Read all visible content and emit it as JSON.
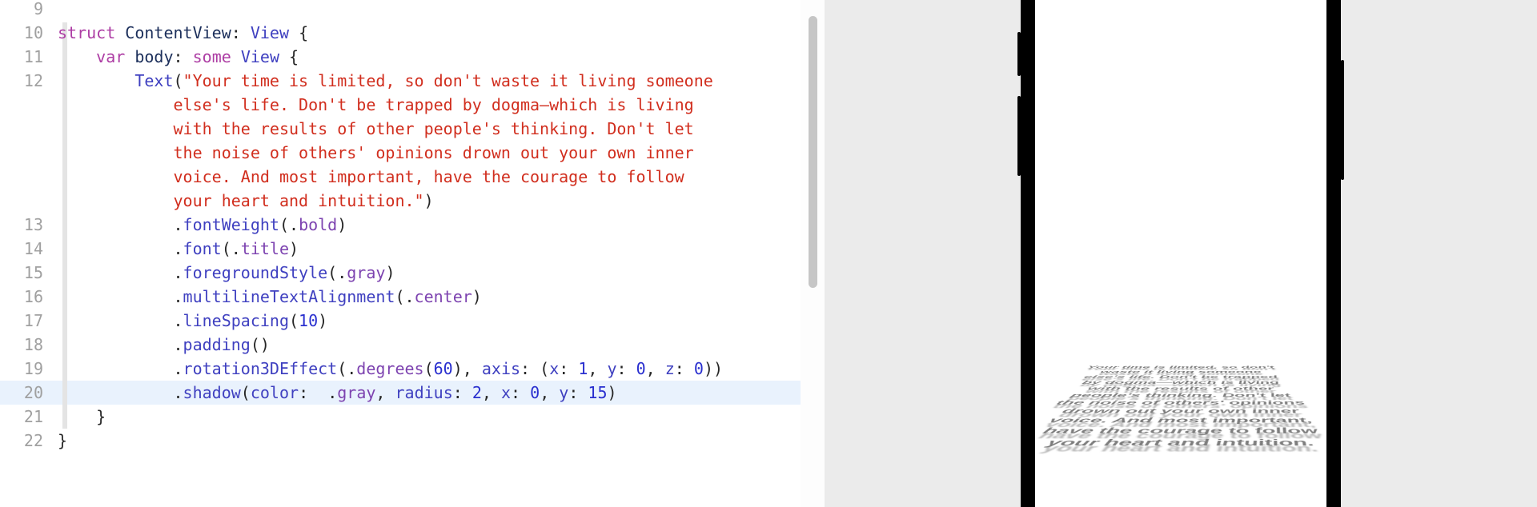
{
  "code": {
    "quote_text": "Your time is limited, so don't waste it living someone else's life. Don't be trapped by dogma—which is living with the results of other people's thinking. Don't let the noise of others' opinions drown out your own inner voice. And most important, have the courage to follow your heart and intuition.",
    "lines": {
      "l9": {
        "num": "9"
      },
      "l10": {
        "num": "10",
        "kw_struct": "struct",
        "name": "ContentView",
        "colon": ":",
        "type": "View",
        "brace": "{"
      },
      "l11": {
        "num": "11",
        "kw_var": "var",
        "name": "body",
        "colon": ":",
        "kw_some": "some",
        "type": "View",
        "brace": "{"
      },
      "l12": {
        "num": "12",
        "callee": "Text",
        "open": "(\"",
        "s1": "Your time is limited, so don't waste it living someone",
        "s2": "else's life. Don't be trapped by dogma—which is living",
        "s3": "with the results of other people's thinking. Don't let",
        "s4": "the noise of others' opinions drown out your own inner",
        "s5": "voice. And most important, have the courage to follow",
        "s6": "your heart and intuition.\"",
        "close": ")"
      },
      "l13": {
        "num": "13",
        "dot": ".",
        "call": "fontWeight",
        "open": "(",
        "arg": ".bold",
        "close": ")"
      },
      "l14": {
        "num": "14",
        "dot": ".",
        "call": "font",
        "open": "(",
        "arg": ".title",
        "close": ")"
      },
      "l15": {
        "num": "15",
        "dot": ".",
        "call": "foregroundStyle",
        "open": "(",
        "arg": ".gray",
        "close": ")"
      },
      "l16": {
        "num": "16",
        "dot": ".",
        "call": "multilineTextAlignment",
        "open": "(",
        "arg": ".center",
        "close": ")"
      },
      "l17": {
        "num": "17",
        "dot": ".",
        "call": "lineSpacing",
        "open": "(",
        "arg": "10",
        "close": ")"
      },
      "l18": {
        "num": "18",
        "dot": ".",
        "call": "padding",
        "open": "(",
        "close": ")"
      },
      "l19": {
        "num": "19",
        "dot": ".",
        "call": "rotation3DEffect",
        "open": "(",
        "deg_member": ".degrees",
        "deg_open": "(",
        "deg_val": "60",
        "deg_close": ")",
        "comma1": ", ",
        "axis_label": "axis",
        "axis_colon": ": ",
        "axp_open": "(",
        "xlab": "x",
        "xcolon": ": ",
        "xval": "1",
        "c2": ", ",
        "ylab": "y",
        "ycolon": ": ",
        "yval": "0",
        "c3": ", ",
        "zlab": "z",
        "zcolon": ": ",
        "zval": "0",
        "axp_close": ")",
        "close": ")"
      },
      "l20": {
        "num": "20",
        "dot": ".",
        "call": "shadow",
        "open": "(",
        "clab": "color",
        "ccolon": ": ",
        "cval": ".gray",
        "c1": ", ",
        "rlab": "radius",
        "rcolon": ": ",
        "rval": "2",
        "c2": ", ",
        "xlab": "x",
        "xcolon": ": ",
        "xval": "0",
        "c3": ", ",
        "ylab": "y",
        "ycolon": ": ",
        "yval": "15",
        "close": ")"
      },
      "l21": {
        "num": "21",
        "brace": "}"
      },
      "l22": {
        "num": "22",
        "brace": "}"
      }
    }
  },
  "preview": {
    "text": "Your time is limited, so don't waste it living someone else's life. Don't be trapped by dogma—which is living with the results of other people's thinking. Don't let the noise of others' opinions drown out your own inner voice. And most important, have the courage to follow your heart and intuition."
  },
  "colors": {
    "keyword": "#ad3da4",
    "type": "#3f40c0",
    "member": "#7d43b0",
    "string": "#d12e1e",
    "number": "#292fcf",
    "gutter": "#a0a0a0",
    "highlight_line": "#e9f2fd",
    "preview_bg": "#ebebeb"
  }
}
